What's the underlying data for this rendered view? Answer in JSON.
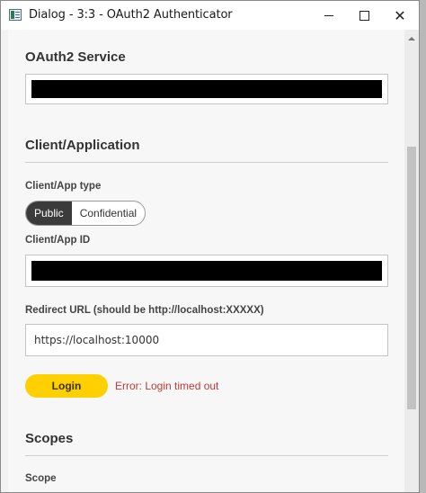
{
  "window": {
    "title": "Dialog - 3:3 - OAuth2 Authenticator",
    "icon": "app-window-icon",
    "controls": [
      "minimize-icon",
      "maximize-icon",
      "close-icon"
    ],
    "close_glyph": "✕"
  },
  "oauth_service": {
    "heading": "OAuth2 Service",
    "value": ""
  },
  "client_application": {
    "heading": "Client/Application",
    "app_type_label": "Client/App type",
    "app_type_options": [
      "Public",
      "Confidential"
    ],
    "app_type_selected": "Public",
    "app_id_label": "Client/App ID",
    "app_id_value": "",
    "redirect_label": "Redirect URL (should be http://localhost:XXXXX)",
    "redirect_value": "https://localhost:10000",
    "login_label": "Login",
    "error_message": "Error: Login timed out"
  },
  "scopes": {
    "heading": "Scopes",
    "scope_label": "Scope"
  },
  "colors": {
    "login_button": "#ffd000",
    "error_text": "#c13838",
    "segment_active": "#3b3b3b"
  }
}
